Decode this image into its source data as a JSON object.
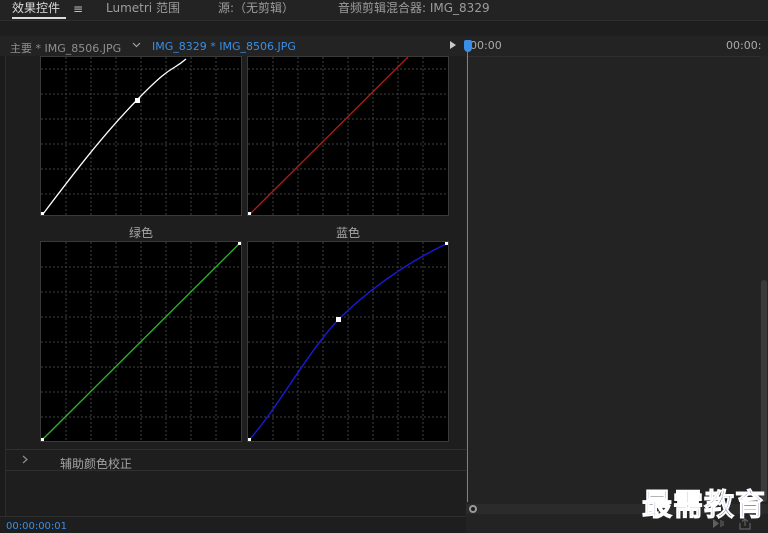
{
  "panel_tabs": {
    "effect_controls": "效果控件",
    "menu_icon": "≡",
    "lumetri_scopes": "Lumetri 范围",
    "source": "源:（无剪辑）",
    "audio_mixer": "音频剪辑混合器: IMG_8329"
  },
  "sequence": {
    "master_clip": "主要 * IMG_8506.JPG",
    "dropdown_icon": "chevron-down-icon",
    "active_clip": "IMG_8329 * IMG_8506.JPG"
  },
  "curves": {
    "green_label": "绿色",
    "blue_label": "蓝色",
    "colors": {
      "master": "#ffffff",
      "red": "#b01c1c",
      "green": "#2fb52f",
      "blue": "#1a1ad6"
    }
  },
  "section": {
    "expand_icon": "chevron-right-icon",
    "label": "辅助颜色校正"
  },
  "footer": {
    "timecode": "00:00:00:01"
  },
  "timeline": {
    "start_time": "00:00",
    "end_time": "00:00:",
    "accent": "#3a8ee6"
  },
  "watermark": "最需教育"
}
